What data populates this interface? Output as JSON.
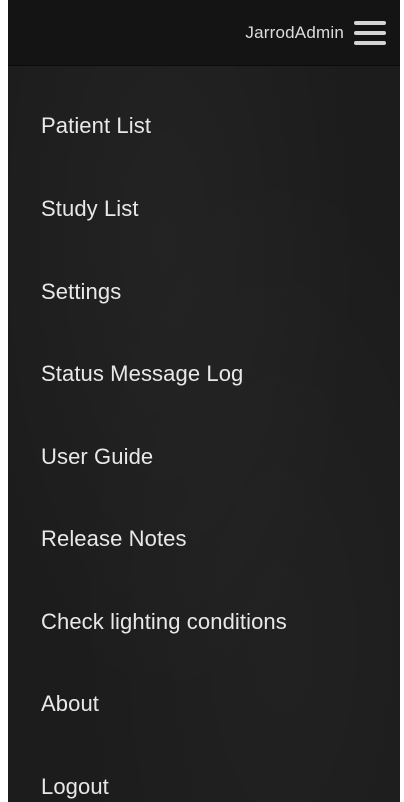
{
  "header": {
    "username": "JarrodAdmin",
    "menu_icon": "hamburger-menu-icon"
  },
  "menu": {
    "items": [
      {
        "label": "Patient List"
      },
      {
        "label": "Study List"
      },
      {
        "label": "Settings"
      },
      {
        "label": "Status Message Log"
      },
      {
        "label": "User Guide"
      },
      {
        "label": "Release Notes"
      },
      {
        "label": "Check lighting conditions"
      },
      {
        "label": "About"
      },
      {
        "label": "Logout"
      }
    ]
  },
  "colors": {
    "panel_background": "#1c1c1c",
    "header_background": "#141414",
    "text": "#e8e8e8"
  }
}
